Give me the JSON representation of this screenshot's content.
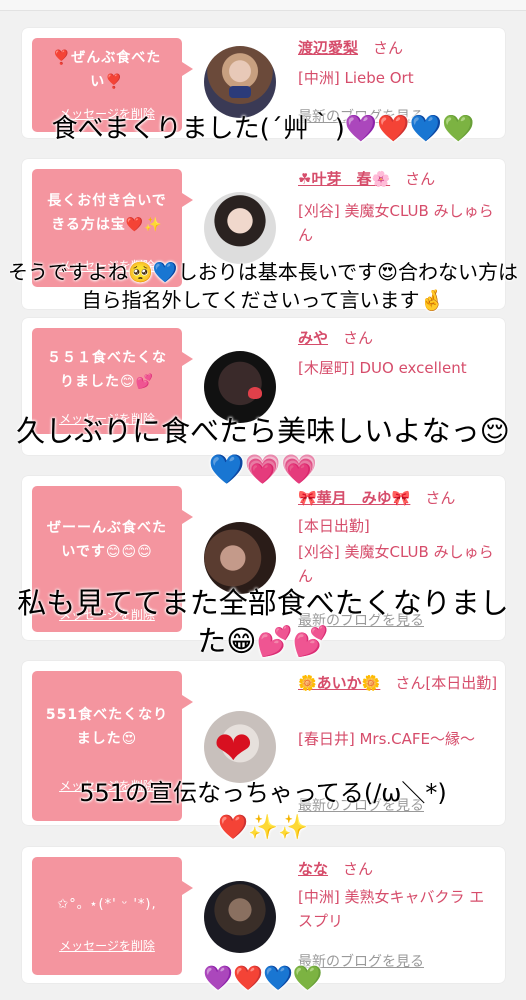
{
  "cards": [
    {
      "message": "❣️ぜんぶ食べたい❣️",
      "delete_label": "メッセージを削除",
      "name": "渡辺愛梨",
      "honorific": "さん",
      "shop": "[中洲] Liebe Ort",
      "blog_label": "最新のブログを見る"
    },
    {
      "message": "長くお付き合いできる方は宝❤️✨",
      "delete_label": "メッセージを削除",
      "name": "☘叶芽　春🌸",
      "honorific": "さん",
      "shop": "[刈谷] 美魔女CLUB みしゅらん",
      "blog_label": "最新のブログを見る"
    },
    {
      "message": "５５１食べたくなりました😊💕",
      "delete_label": "メッセージを削除",
      "name": "みや",
      "honorific": "さん",
      "shop": "[木屋町] DUO excellent",
      "blog_label": "最新のブログを見る"
    },
    {
      "message": "ぜーーんぶ食べたいです😊😊😊",
      "delete_label": "メッセージを削除",
      "name": "🎀華月　みゆ🎀",
      "honorific": "さん",
      "shop_line1": "[本日出勤]",
      "shop": "[刈谷] 美魔女CLUB みしゅらん",
      "blog_label": "最新のブログを見る"
    },
    {
      "message": "551食べたくなりました😍",
      "delete_label": "メッセージを削除",
      "name": "🌼あいか🌼",
      "honorific": "さん[本日出勤]",
      "shop": "[春日井] Mrs.CAFE〜縁〜",
      "blog_label": "最新のブログを見る"
    },
    {
      "message": "✩°｡ ⋆(*' ᵕ '*),",
      "delete_label": "メッセージを削除",
      "name": "なな",
      "honorific": "さん",
      "shop": "[中洲] 美熟女キャバクラ エスプリ",
      "blog_label": "最新のブログを見る"
    }
  ],
  "captions": [
    {
      "text": "食べまくりました(´艸｀)💜❤️💙💚"
    },
    {
      "text": "そうですよね🥺💙しおりは基本長いです😍合わない方は自ら指名外してくださいって言います🤞"
    },
    {
      "text": "久しぶりに食べたら美味しいよなっ😌💙💗💗"
    },
    {
      "text": "私も見ててまた全部食べたくなりました😁💕💕"
    },
    {
      "text": "551の宣伝なっちゃってる(/ω＼*)❤️✨✨"
    },
    {
      "text": "💜❤️💙💚"
    }
  ]
}
